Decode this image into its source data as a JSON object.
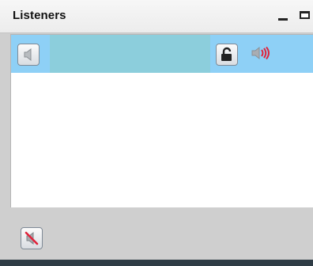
{
  "window": {
    "title": "Listeners"
  },
  "listeners": [
    {
      "name": "",
      "selected": true,
      "icons": {
        "speaker": "speaker-muted-icon",
        "lock": "unlock-icon",
        "volume": "volume-icon"
      }
    }
  ],
  "toolbar": {
    "mute_icon": "mute-speaker-icon"
  },
  "colors": {
    "selection": "#8ed0f6",
    "name_highlight": "#8ccedc",
    "volume_waves": "#e0223a"
  }
}
